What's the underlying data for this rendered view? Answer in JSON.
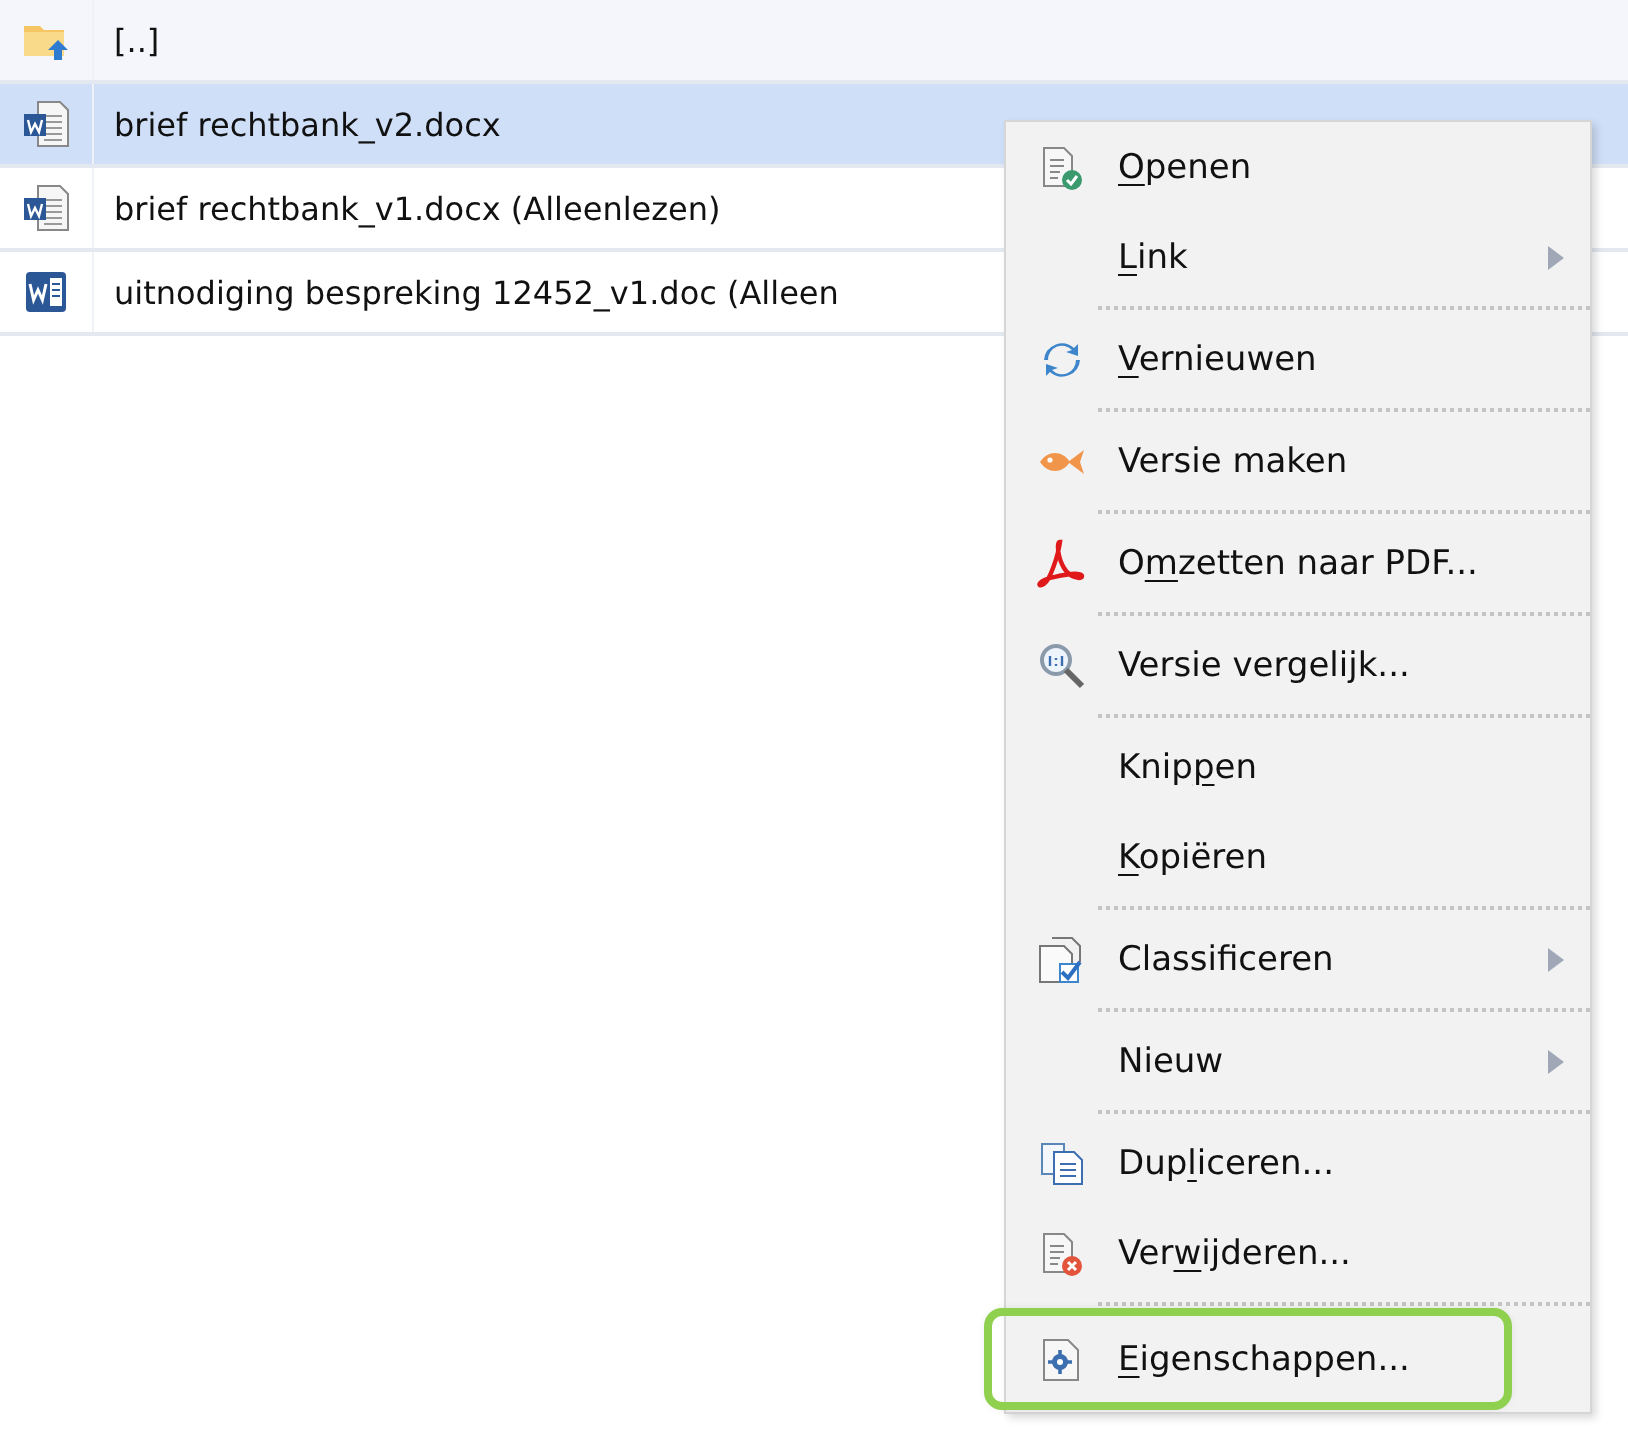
{
  "files": [
    {
      "kind": "parent",
      "name": "[..]",
      "selected": false
    },
    {
      "kind": "docx",
      "name": "brief rechtbank_v2.docx",
      "selected": true
    },
    {
      "kind": "docx",
      "name": "brief rechtbank_v1.docx (Alleenlezen)",
      "selected": false
    },
    {
      "kind": "doc",
      "name": "uitnodiging bespreking 12452_v1.doc (Alleen",
      "selected": false
    }
  ],
  "context_menu": {
    "groups": [
      [
        {
          "kind": "open",
          "mnemonic": "O",
          "after": "penen",
          "submenu": false,
          "highlighted": false
        },
        {
          "kind": "none",
          "mnemonic": "L",
          "after": "ink",
          "submenu": true,
          "highlighted": false
        }
      ],
      [
        {
          "kind": "refresh",
          "mnemonic": "V",
          "after": "ernieuwen",
          "submenu": false,
          "highlighted": false
        }
      ],
      [
        {
          "kind": "fish",
          "before": "Versie maken",
          "submenu": false,
          "highlighted": false
        }
      ],
      [
        {
          "kind": "pdf",
          "before": "O",
          "mnemonic": "m",
          "after": "zetten naar PDF...",
          "submenu": false,
          "highlighted": false
        }
      ],
      [
        {
          "kind": "compare",
          "before": "Versie vergelijk...",
          "submenu": false,
          "highlighted": false
        }
      ],
      [
        {
          "kind": "none",
          "before": "Knip",
          "mnemonic": "p",
          "after": "en",
          "submenu": false,
          "highlighted": false
        },
        {
          "kind": "none",
          "mnemonic": "K",
          "after": "opiëren",
          "submenu": false,
          "highlighted": false
        }
      ],
      [
        {
          "kind": "classify",
          "before": "Classificeren",
          "submenu": true,
          "highlighted": false
        }
      ],
      [
        {
          "kind": "none",
          "before": "Nieuw",
          "submenu": true,
          "highlighted": false
        }
      ],
      [
        {
          "kind": "duplicate",
          "before": "Dup",
          "mnemonic": "l",
          "after": "iceren...",
          "submenu": false,
          "highlighted": false
        },
        {
          "kind": "delete",
          "before": "Ver",
          "mnemonic": "w",
          "after": "ijderen...",
          "submenu": false,
          "highlighted": false
        }
      ],
      [
        {
          "kind": "properties",
          "mnemonic": "E",
          "after": "igenschappen...",
          "submenu": false,
          "highlighted": true
        }
      ]
    ]
  }
}
